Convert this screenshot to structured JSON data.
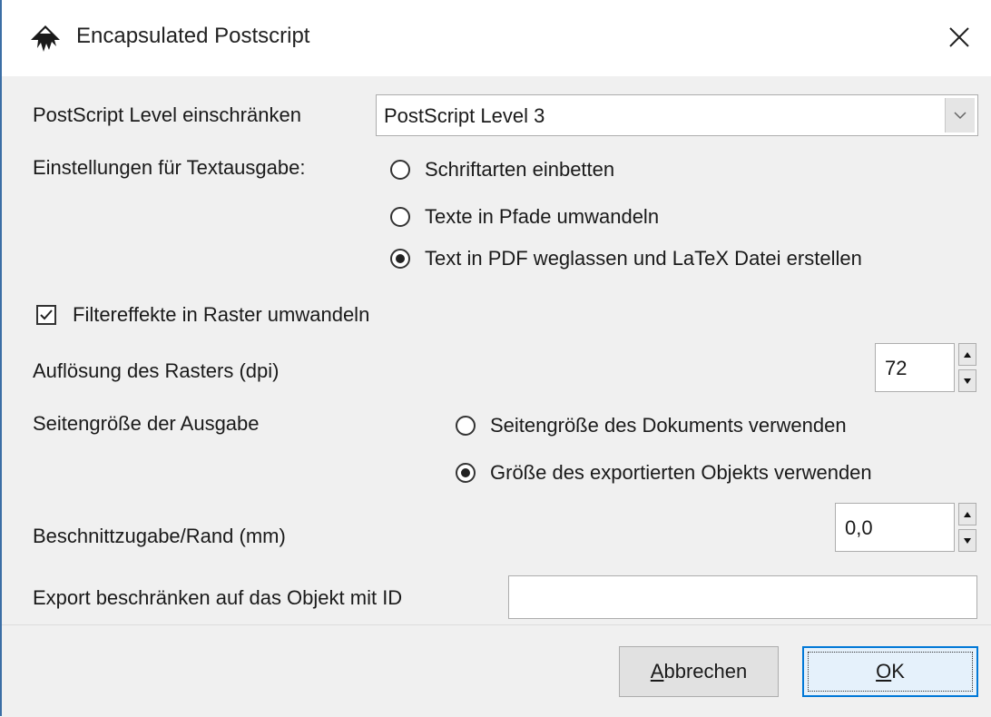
{
  "window": {
    "title": "Encapsulated Postscript"
  },
  "icons": {
    "app": "inkscape-icon",
    "close": "close-icon"
  },
  "ps_level": {
    "label": "PostScript Level einschränken",
    "value": "PostScript Level 3"
  },
  "text_output": {
    "label": "Einstellungen für Textausgabe:",
    "options": [
      {
        "label": "Schriftarten einbetten",
        "checked": false
      },
      {
        "label": "Texte in Pfade umwandeln",
        "checked": false
      },
      {
        "label": "Text in PDF weglassen und LaTeX Datei erstellen",
        "checked": true
      }
    ]
  },
  "filter_effects": {
    "label": "Filtereffekte in Raster umwandeln",
    "checked": true
  },
  "resolution": {
    "label": "Auflösung des Rasters (dpi)",
    "value": "72"
  },
  "page_size": {
    "label": "Seitengröße der Ausgabe",
    "options": [
      {
        "label": "Seitengröße des Dokuments verwenden",
        "checked": false
      },
      {
        "label": "Größe des exportierten Objekts verwenden",
        "checked": true
      }
    ]
  },
  "bleed": {
    "label": "Beschnittzugabe/Rand (mm)",
    "value": "0,0"
  },
  "export_id": {
    "label": "Export beschränken auf das Objekt mit ID",
    "value": ""
  },
  "buttons": {
    "cancel": {
      "mnemonic": "A",
      "rest": "bbrechen"
    },
    "ok": {
      "mnemonic": "O",
      "rest": "K"
    }
  },
  "colors": {
    "accent": "#0078d7",
    "window_border": "#3b6ea5",
    "panel": "#f0f0f0"
  }
}
